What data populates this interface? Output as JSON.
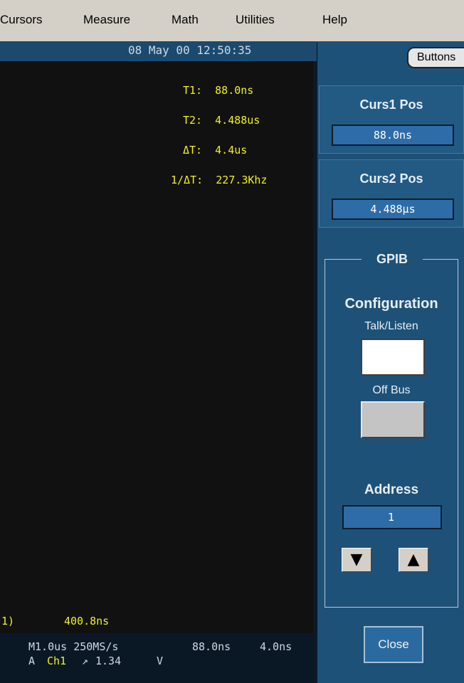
{
  "menu": [
    "Cursors",
    "Measure",
    "Math",
    "Utilities",
    "Help"
  ],
  "datetime": "08 May 00 12:50:35",
  "buttons_label": "Buttons",
  "readouts": {
    "t1": "T1:  88.0ns",
    "t2": "T2:  4.488us",
    "dt": "ΔT:  4.4us",
    "inv_dt": "1/ΔT:  227.3Khz"
  },
  "channel_marker": "1)",
  "bottom_value": "400.8ns",
  "status": {
    "timebase": "M1.0us 250MS/s",
    "cursor1": "88.0ns",
    "cursor2": "4.0ns",
    "trigger_prefix": "A",
    "channel": "Ch1",
    "slope_icon": "↗",
    "level": "1.34",
    "unit": "V"
  },
  "curs1": {
    "title": "Curs1 Pos",
    "value": "88.0ns"
  },
  "curs2": {
    "title": "Curs2 Pos",
    "value": "4.488µs"
  },
  "gpib": {
    "title": "GPIB",
    "configuration": "Configuration",
    "talk_listen": "Talk/Listen",
    "off_bus": "Off Bus",
    "address_label": "Address",
    "address_value": "1",
    "down_arrow": "▼",
    "up_arrow": "▲"
  },
  "close_label": "Close"
}
